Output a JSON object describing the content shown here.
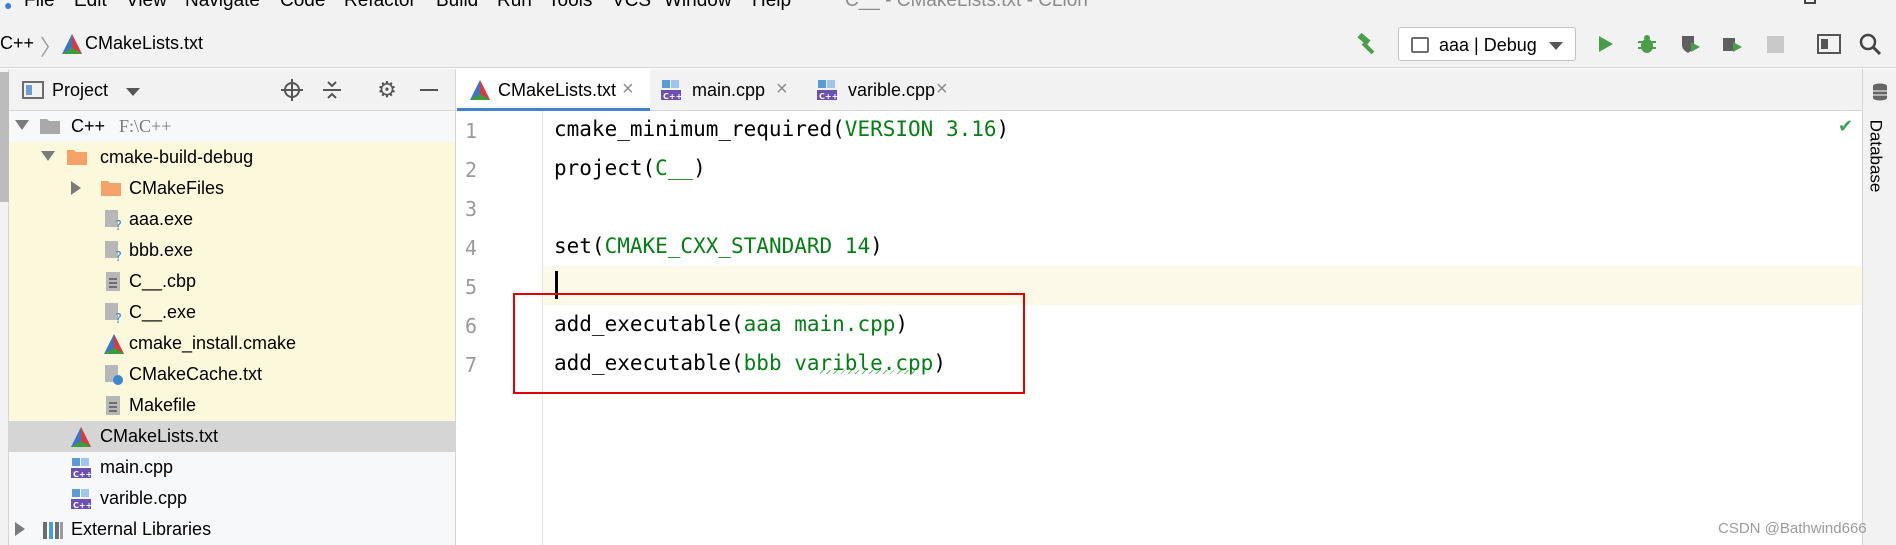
{
  "window": {
    "title": "C__ - CMakeLists.txt - CLion",
    "menu": [
      "File",
      "Edit",
      "View",
      "Navigate",
      "Code",
      "Refactor",
      "Build",
      "Run",
      "Tools",
      "VCS",
      "Window",
      "Help"
    ]
  },
  "navbar": {
    "breadcrumb_root": "C++",
    "breadcrumb_file": "CMakeLists.txt",
    "run_config": "aaa | Debug"
  },
  "project": {
    "title": "Project",
    "tree": [
      {
        "label": "C++",
        "path": "F:\\C++",
        "icon": "folder-icon"
      },
      {
        "label": "cmake-build-debug",
        "icon": "orange-folder-icon"
      },
      {
        "label": "CMakeFiles",
        "icon": "orange-folder-icon"
      },
      {
        "label": "aaa.exe",
        "icon": "executable-icon"
      },
      {
        "label": "bbb.exe",
        "icon": "executable-icon"
      },
      {
        "label": "C__.cbp",
        "icon": "text-file-icon"
      },
      {
        "label": "C__.exe",
        "icon": "executable-icon"
      },
      {
        "label": "cmake_install.cmake",
        "icon": "cmake-icon"
      },
      {
        "label": "CMakeCache.txt",
        "icon": "cmake-cache-icon"
      },
      {
        "label": "Makefile",
        "icon": "text-file-icon"
      },
      {
        "label": "CMakeLists.txt",
        "icon": "cmake-icon"
      },
      {
        "label": "main.cpp",
        "icon": "cpp-file-icon"
      },
      {
        "label": "varible.cpp",
        "icon": "cpp-file-icon"
      },
      {
        "label": "External Libraries",
        "icon": "library-icon"
      }
    ]
  },
  "editor": {
    "tabs": [
      {
        "label": "CMakeLists.txt",
        "active": true
      },
      {
        "label": "main.cpp",
        "active": false
      },
      {
        "label": "varible.cpp",
        "active": false
      }
    ],
    "lines": [
      {
        "n": "1",
        "fn": "cmake_minimum_required(",
        "arg": "VERSION 3.16",
        "end": ")"
      },
      {
        "n": "2",
        "fn": "project(",
        "arg": "C__",
        "end": ")"
      },
      {
        "n": "3",
        "fn": "",
        "arg": "",
        "end": ""
      },
      {
        "n": "4",
        "fn": "set(",
        "arg": "CMAKE_CXX_STANDARD 14",
        "end": ")"
      },
      {
        "n": "5",
        "fn": "",
        "arg": "",
        "end": ""
      },
      {
        "n": "6",
        "fn": "add_executable(",
        "arg": "aaa main.cpp",
        "end": ")"
      },
      {
        "n": "7",
        "fn": "add_executable(",
        "arg": "bbb varible.cpp",
        "end": ")"
      }
    ]
  },
  "right_panel": {
    "database_label": "Database"
  },
  "watermark": "CSDN @Bathwind666",
  "colors": {
    "accent": "#4083c9",
    "keyword_green": "#067d17",
    "highlight_box": "#e30000"
  }
}
